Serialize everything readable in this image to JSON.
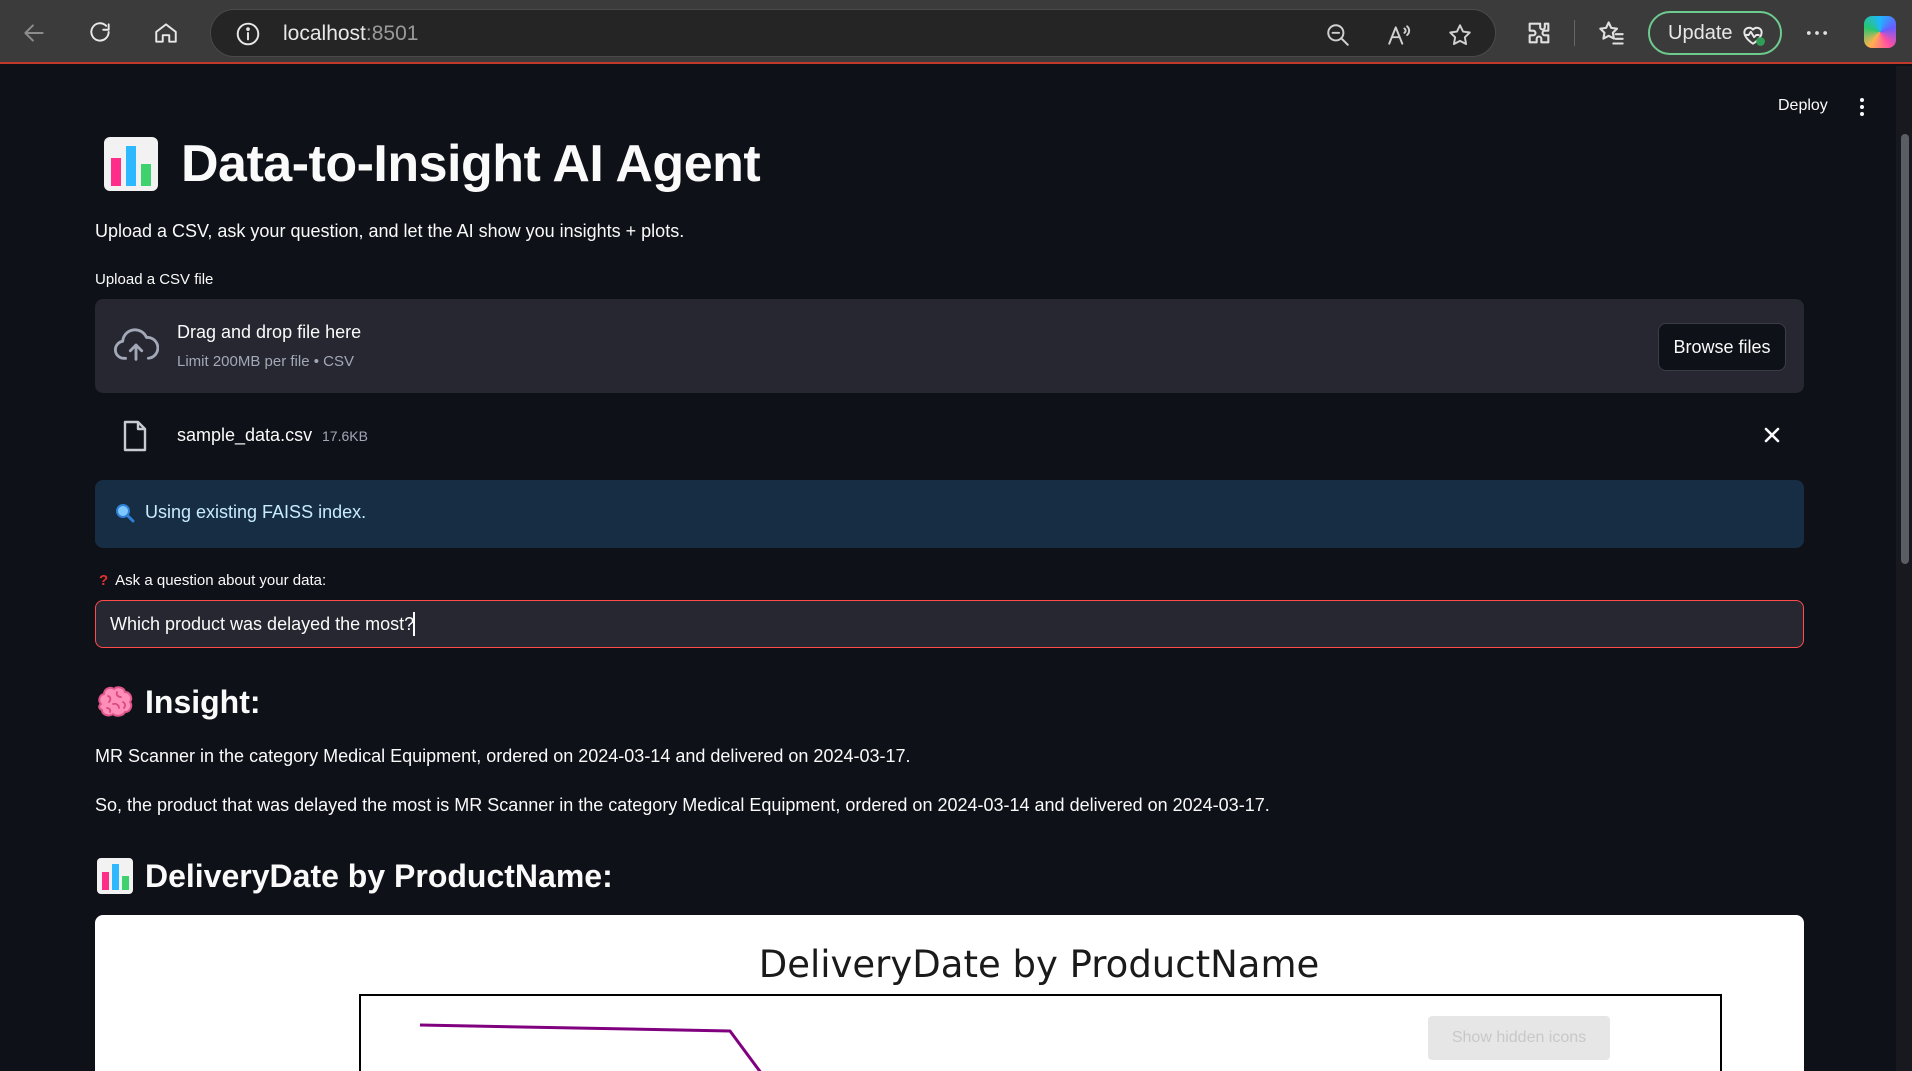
{
  "browser": {
    "url_host": "localhost",
    "url_port": ":8501",
    "update_label": "Update"
  },
  "app": {
    "deploy_label": "Deploy",
    "title": "Data-to-Insight AI Agent",
    "subtitle": "Upload a CSV, ask your question, and let the AI show you insights + plots.",
    "uploader": {
      "label": "Upload a CSV file",
      "drop_title": "Drag and drop file here",
      "drop_limit": "Limit 200MB per file • CSV",
      "browse_label": "Browse files"
    },
    "file": {
      "name": "sample_data.csv",
      "size": "17.6KB"
    },
    "info": {
      "text": "Using existing FAISS index."
    },
    "question": {
      "label": "Ask a question about your data:",
      "value": "Which product was delayed the most?"
    },
    "insight": {
      "heading": "Insight:",
      "paragraph_1": "MR Scanner in the category Medical Equipment, ordered on 2024-03-14 and delivered on 2024-03-17.",
      "paragraph_2": "So, the product that was delayed the most is MR Scanner in the category Medical Equipment, ordered on 2024-03-14 and delivered on 2024-03-17."
    },
    "chart_section": {
      "heading": "DeliveryDate by ProductName:"
    },
    "tooltip": "Show hidden icons",
    "colors": {
      "accent_red": "#ff4b4b",
      "info_bg": "#172d43",
      "info_text": "#c7ebff",
      "update_border": "#6ecb8f",
      "line_color": "#800080"
    }
  },
  "chart_data": {
    "type": "line",
    "title": "DeliveryDate by ProductName",
    "xlabel": "",
    "ylabel": "",
    "series": [
      {
        "values": []
      }
    ],
    "grid": false
  }
}
